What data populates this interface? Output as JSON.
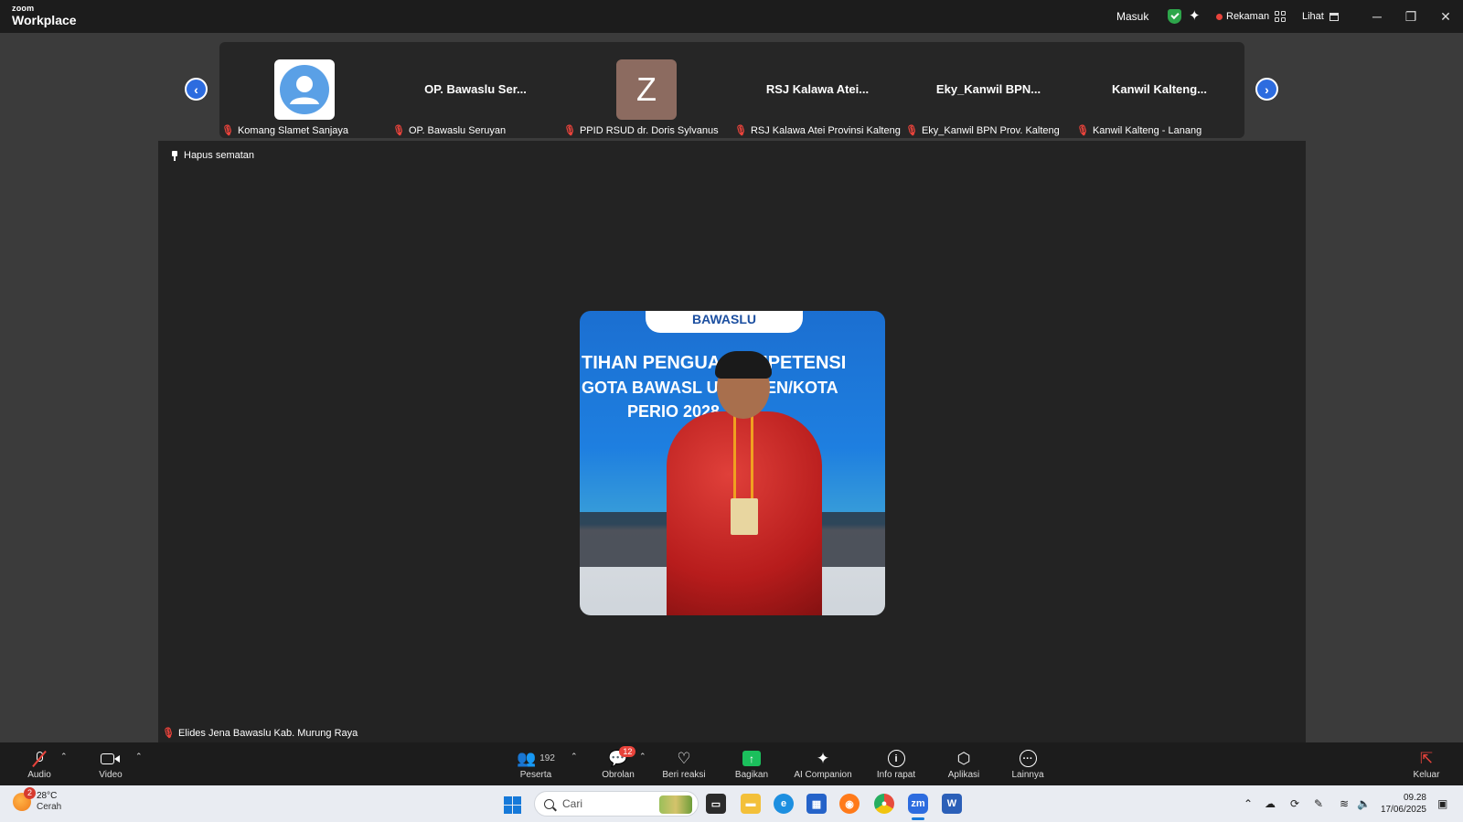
{
  "app": {
    "logo_small": "zoom",
    "logo_big": "Workplace",
    "masuk": "Masuk",
    "recording": "Rekaman",
    "view": "Lihat"
  },
  "strip": {
    "tiles": [
      {
        "display": "",
        "label": "Komang Slamet Sanjaya"
      },
      {
        "display": "OP. Bawaslu Ser...",
        "label": "OP. Bawaslu Seruyan"
      },
      {
        "display": "Z",
        "label": "PPID RSUD dr. Doris Sylvanus"
      },
      {
        "display": "RSJ Kalawa Atei...",
        "label": "RSJ Kalawa Atei Provinsi Kalteng"
      },
      {
        "display": "Eky_Kanwil  BPN...",
        "label": "Eky_Kanwil BPN Prov. Kalteng"
      },
      {
        "display": "Kanwil  Kalteng...",
        "label": "Kanwil Kalteng - Lanang"
      }
    ]
  },
  "stage": {
    "unpin": "Hapus sematan",
    "speaker_label": "Elides Jena Bawaslu Kab.  Murung Raya",
    "photo_banner": "BAWASLU",
    "photo_line1": "TIHAN PENGUA    KOMPETENSI",
    "photo_line2": "GOTA BAWASL U    UPATEN/KOTA",
    "photo_line3": "PERIO         2028"
  },
  "toolbar": {
    "audio": "Audio",
    "video": "Video",
    "participants": "Peserta",
    "participants_count": "192",
    "chat": "Obrolan",
    "chat_badge": "12",
    "react": "Beri reaksi",
    "share": "Bagikan",
    "ai": "AI Companion",
    "info": "Info rapat",
    "apps": "Aplikasi",
    "more": "Lainnya",
    "leave": "Keluar"
  },
  "taskbar": {
    "temp": "28°C",
    "weather": "Cerah",
    "weather_badge": "2",
    "search_placeholder": "Cari",
    "time": "09.28",
    "date": "17/06/2025"
  },
  "colors": {
    "accent": "#2d6cdf",
    "mic_off": "#e8433b",
    "share": "#1bbf5c"
  }
}
